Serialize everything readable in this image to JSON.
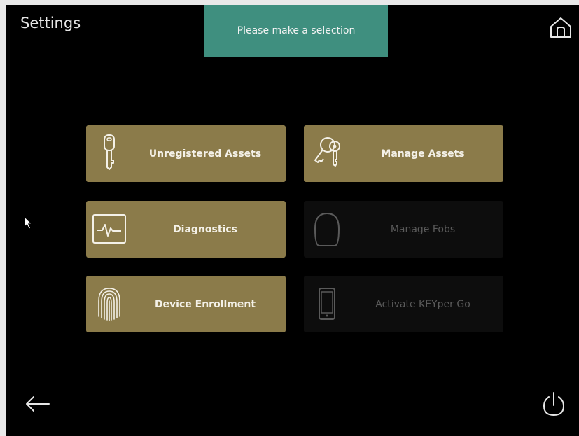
{
  "header": {
    "title": "Settings",
    "toast": "Please make a selection",
    "home_icon": "home-icon"
  },
  "tiles": [
    {
      "label": "Unregistered Assets",
      "icon": "key-icon",
      "enabled": true
    },
    {
      "label": "Manage Assets",
      "icon": "keys-icon",
      "enabled": true
    },
    {
      "label": "Diagnostics",
      "icon": "pulse-monitor-icon",
      "enabled": true
    },
    {
      "label": "Manage Fobs",
      "icon": "fob-icon",
      "enabled": false
    },
    {
      "label": "Device Enrollment",
      "icon": "fingerprint-icon",
      "enabled": true
    },
    {
      "label": "Activate KEYper Go",
      "icon": "phone-icon",
      "enabled": false
    }
  ],
  "footer": {
    "back_icon": "back-arrow-icon",
    "power_icon": "power-icon"
  },
  "colors": {
    "background": "#000000",
    "tile_active": "#8b7b4a",
    "tile_disabled": "#0d0d0d",
    "toast": "#3f8f7f"
  }
}
